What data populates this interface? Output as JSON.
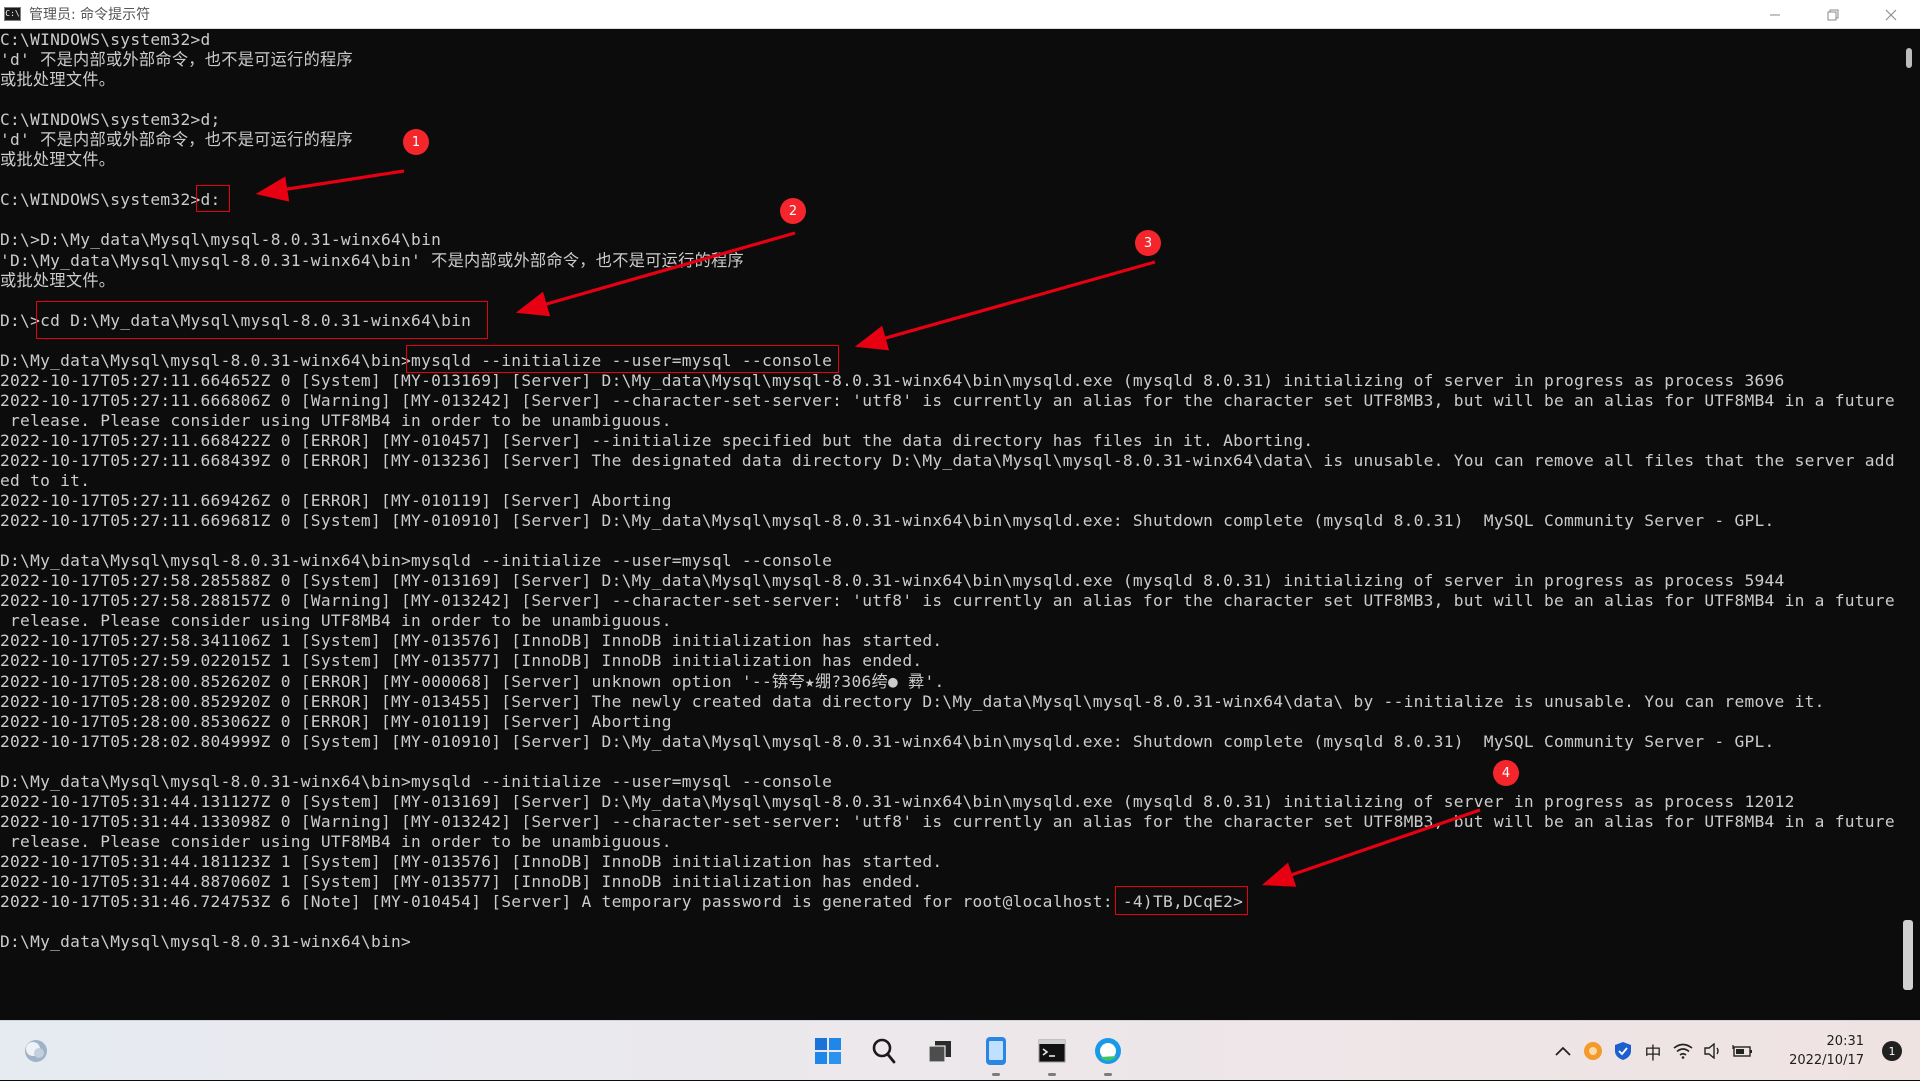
{
  "window": {
    "title": "管理员: 命令提示符",
    "icon_text": "C:\\"
  },
  "console": {
    "lines": [
      "C:\\WINDOWS\\system32>d",
      "'d' 不是内部或外部命令，也不是可运行的程序",
      "或批处理文件。",
      "",
      "C:\\WINDOWS\\system32>d;",
      "'d' 不是内部或外部命令，也不是可运行的程序",
      "或批处理文件。",
      "",
      "C:\\WINDOWS\\system32>d:",
      "",
      "D:\\>D:\\My_data\\Mysql\\mysql-8.0.31-winx64\\bin",
      "'D:\\My_data\\Mysql\\mysql-8.0.31-winx64\\bin' 不是内部或外部命令，也不是可运行的程序",
      "或批处理文件。",
      "",
      "D:\\>cd D:\\My_data\\Mysql\\mysql-8.0.31-winx64\\bin",
      "",
      "D:\\My_data\\Mysql\\mysql-8.0.31-winx64\\bin>mysqld --initialize --user=mysql --console",
      "2022-10-17T05:27:11.664652Z 0 [System] [MY-013169] [Server] D:\\My_data\\Mysql\\mysql-8.0.31-winx64\\bin\\mysqld.exe (mysqld 8.0.31) initializing of server in progress as process 3696",
      "2022-10-17T05:27:11.666806Z 0 [Warning] [MY-013242] [Server] --character-set-server: 'utf8' is currently an alias for the character set UTF8MB3, but will be an alias for UTF8MB4 in a future",
      " release. Please consider using UTF8MB4 in order to be unambiguous.",
      "2022-10-17T05:27:11.668422Z 0 [ERROR] [MY-010457] [Server] --initialize specified but the data directory has files in it. Aborting.",
      "2022-10-17T05:27:11.668439Z 0 [ERROR] [MY-013236] [Server] The designated data directory D:\\My_data\\Mysql\\mysql-8.0.31-winx64\\data\\ is unusable. You can remove all files that the server add",
      "ed to it.",
      "2022-10-17T05:27:11.669426Z 0 [ERROR] [MY-010119] [Server] Aborting",
      "2022-10-17T05:27:11.669681Z 0 [System] [MY-010910] [Server] D:\\My_data\\Mysql\\mysql-8.0.31-winx64\\bin\\mysqld.exe: Shutdown complete (mysqld 8.0.31)  MySQL Community Server - GPL.",
      "",
      "D:\\My_data\\Mysql\\mysql-8.0.31-winx64\\bin>mysqld --initialize --user=mysql --console",
      "2022-10-17T05:27:58.285588Z 0 [System] [MY-013169] [Server] D:\\My_data\\Mysql\\mysql-8.0.31-winx64\\bin\\mysqld.exe (mysqld 8.0.31) initializing of server in progress as process 5944",
      "2022-10-17T05:27:58.288157Z 0 [Warning] [MY-013242] [Server] --character-set-server: 'utf8' is currently an alias for the character set UTF8MB3, but will be an alias for UTF8MB4 in a future",
      " release. Please consider using UTF8MB4 in order to be unambiguous.",
      "2022-10-17T05:27:58.341106Z 1 [System] [MY-013576] [InnoDB] InnoDB initialization has started.",
      "2022-10-17T05:27:59.022015Z 1 [System] [MY-013577] [InnoDB] InnoDB initialization has ended.",
      "2022-10-17T05:28:00.852620Z 0 [ERROR] [MY-000068] [Server] unknown option '--锛夸★绷?306绔● 彛'.",
      "2022-10-17T05:28:00.852920Z 0 [ERROR] [MY-013455] [Server] The newly created data directory D:\\My_data\\Mysql\\mysql-8.0.31-winx64\\data\\ by --initialize is unusable. You can remove it.",
      "2022-10-17T05:28:00.853062Z 0 [ERROR] [MY-010119] [Server] Aborting",
      "2022-10-17T05:28:02.804999Z 0 [System] [MY-010910] [Server] D:\\My_data\\Mysql\\mysql-8.0.31-winx64\\bin\\mysqld.exe: Shutdown complete (mysqld 8.0.31)  MySQL Community Server - GPL.",
      "",
      "D:\\My_data\\Mysql\\mysql-8.0.31-winx64\\bin>mysqld --initialize --user=mysql --console",
      "2022-10-17T05:31:44.131127Z 0 [System] [MY-013169] [Server] D:\\My_data\\Mysql\\mysql-8.0.31-winx64\\bin\\mysqld.exe (mysqld 8.0.31) initializing of server in progress as process 12012",
      "2022-10-17T05:31:44.133098Z 0 [Warning] [MY-013242] [Server] --character-set-server: 'utf8' is currently an alias for the character set UTF8MB3, but will be an alias for UTF8MB4 in a future",
      " release. Please consider using UTF8MB4 in order to be unambiguous.",
      "2022-10-17T05:31:44.181123Z 1 [System] [MY-013576] [InnoDB] InnoDB initialization has started.",
      "2022-10-17T05:31:44.887060Z 1 [System] [MY-013577] [InnoDB] InnoDB initialization has ended.",
      "2022-10-17T05:31:46.724753Z 6 [Note] [MY-010454] [Server] A temporary password is generated for root@localhost: -4)TB,DCqE2>",
      "",
      "D:\\My_data\\Mysql\\mysql-8.0.31-winx64\\bin>"
    ]
  },
  "annotations": {
    "badges": [
      "1",
      "2",
      "3",
      "4"
    ],
    "color": "#e60012"
  },
  "taskbar": {
    "apps": [
      "start-icon",
      "search-icon",
      "task-view-icon",
      "phone-link-icon",
      "terminal-icon",
      "browser-icon"
    ],
    "tray": {
      "chevron": "^",
      "ime": "中",
      "time": "20:31",
      "date": "2022/10/17",
      "notifications": "1"
    }
  }
}
